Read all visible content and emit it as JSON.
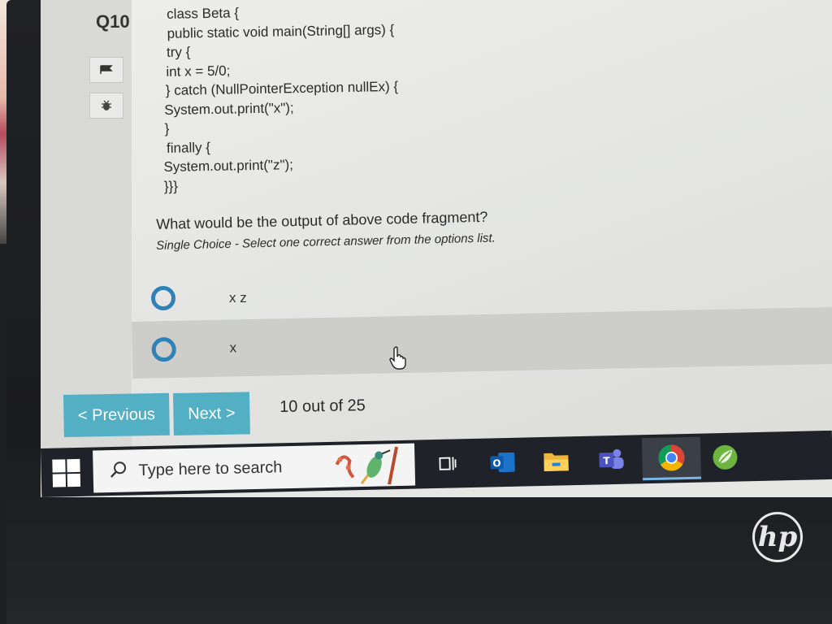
{
  "question": {
    "number": "Q10",
    "code_lines": [
      "class Beta {",
      "public static void main(String[] args) {",
      "try {",
      "int x = 5/0;",
      "} catch (NullPointerException nullEx) {",
      "System.out.print(\"x\");",
      "}",
      "finally {",
      "System.out.print(\"z\");",
      "}}}"
    ],
    "prompt": "What would be the output of above code fragment?",
    "instruction": "Single Choice - Select one correct answer from the options list."
  },
  "options": [
    {
      "label": "x z"
    },
    {
      "label": "x"
    }
  ],
  "navigation": {
    "previous_label": "< Previous",
    "next_label": "Next >",
    "progress": "10 out of 25"
  },
  "taskbar": {
    "search_placeholder": "Type here to search",
    "apps": [
      "task-view-icon",
      "outlook-icon",
      "file-explorer-icon",
      "teams-icon",
      "chrome-icon",
      "spring-tools-icon"
    ]
  },
  "colors": {
    "accent": "#52afc4",
    "radio": "#2f82b8"
  },
  "brand": "hp"
}
